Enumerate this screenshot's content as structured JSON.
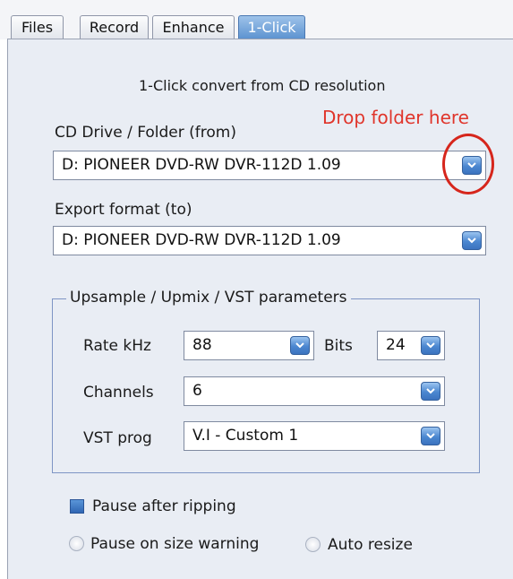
{
  "tabs": [
    {
      "label": "Files",
      "active": false
    },
    {
      "label": "Record",
      "active": false
    },
    {
      "label": "Enhance",
      "active": false
    },
    {
      "label": "1-Click",
      "active": true
    }
  ],
  "panel": {
    "heading": "1-Click convert from CD resolution",
    "drop_note": "Drop folder here",
    "cd_drive": {
      "label": "CD Drive / Folder (from)",
      "value": "D: PIONEER  DVD-RW  DVR-112D 1.09"
    },
    "export_format": {
      "label": "Export format (to)",
      "value": "D: PIONEER  DVD-RW  DVR-112D 1.09"
    },
    "group": {
      "title": "Upsample / Upmix / VST parameters",
      "rate": {
        "label": "Rate kHz",
        "value": "88"
      },
      "bits": {
        "label": "Bits",
        "value": "24"
      },
      "channels": {
        "label": "Channels",
        "value": "6"
      },
      "vst": {
        "label": "VST prog",
        "value": "V.I - Custom 1"
      }
    },
    "options": {
      "pause_ripping": {
        "label": "Pause after ripping",
        "checked": true
      },
      "pause_size": {
        "label": "Pause on size warning",
        "checked": false
      },
      "auto_resize": {
        "label": "Auto resize",
        "checked": false
      }
    }
  },
  "colors": {
    "accent": "#5d93d1",
    "annotation": "#e0352b",
    "panel_bg": "#e9edf4"
  },
  "icons": [
    "dropdown-arrow-icon"
  ]
}
